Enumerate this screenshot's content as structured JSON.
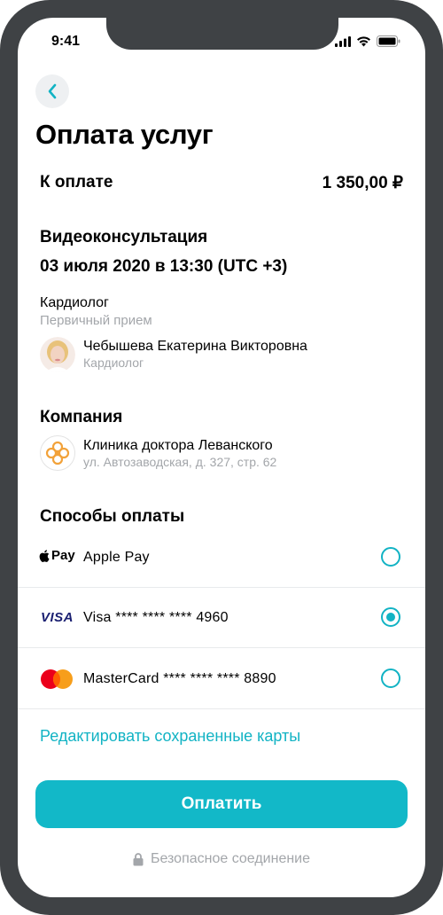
{
  "status_bar": {
    "time": "9:41"
  },
  "header": {
    "title": "Оплата услуг"
  },
  "total": {
    "label": "К оплате",
    "amount": "1 350,00 ₽"
  },
  "consultation": {
    "type": "Видеоконсультация",
    "datetime": "03 июля 2020 в 13:30 (UTC +3)",
    "specialty": "Кардиолог",
    "visit_type": "Первичный прием",
    "doctor_name": "Чебышева Екатерина Викторовна",
    "doctor_role": "Кардиолог"
  },
  "company": {
    "title": "Компания",
    "name": "Клиника доктора Леванского",
    "address": "ул. Автозаводская, д. 327, стр. 62"
  },
  "payment": {
    "title": "Способы оплаты",
    "methods": [
      {
        "logo": "Pay",
        "label": "Apple Pay",
        "selected": false
      },
      {
        "logo": "VISA",
        "label": "Visa **** **** **** 4960",
        "selected": true
      },
      {
        "logo": "mastercard-logo",
        "label": "MasterCard **** **** **** 8890",
        "selected": false
      }
    ],
    "edit_link": "Редактировать сохраненные карты",
    "pay_button": "Оплатить",
    "secure_text": "Безопасное соединение"
  },
  "colors": {
    "accent": "#12b8c8",
    "frame": "#3f4245",
    "muted": "#a3a6aa"
  }
}
